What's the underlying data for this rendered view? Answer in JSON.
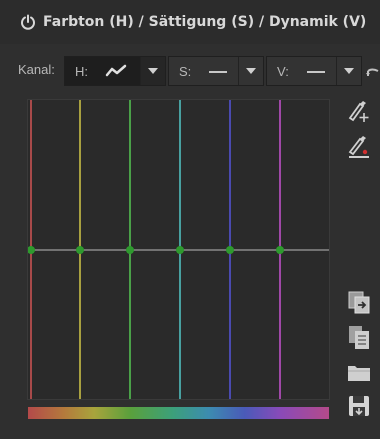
{
  "header": {
    "title": "Farbton (H) / Sättigung (S) / Dynamik (V)",
    "icon": "power-icon"
  },
  "toolbar": {
    "channel_label": "Kanal:",
    "h_combo": {
      "label": "H:",
      "icon": "curve-icon"
    },
    "s_combo": {
      "label": "S:",
      "icon": "flat-line-icon"
    },
    "v_combo": {
      "label": "V:",
      "icon": "flat-line-icon"
    },
    "reset_icon": "undo-icon"
  },
  "side_tools": [
    "pick-point-icon",
    "edit-point-icon",
    "copy-icon",
    "paste-icon",
    "open-folder-icon",
    "save-icon"
  ],
  "graph": {
    "guide_colors": [
      "#a84a4a",
      "#a8a040",
      "#4aa048",
      "#48a0a0",
      "#4a4ab0",
      "#a048a8"
    ],
    "baseline_color": "#8a8a8a",
    "point_color": "#2e9a2e"
  }
}
